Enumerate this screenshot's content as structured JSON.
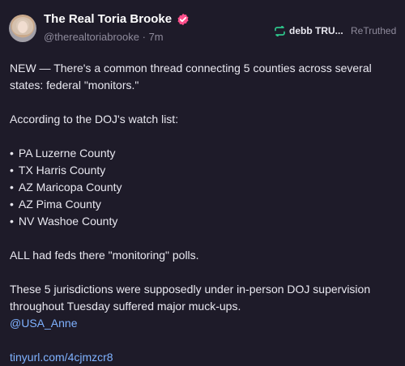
{
  "header": {
    "display_name": "The Real Toria Brooke",
    "handle": "@therealtoriabrooke",
    "separator": "·",
    "time_ago": "7m",
    "retruth_user": "debb TRU...",
    "retruth_label": "ReTruthed"
  },
  "icons": {
    "verified": "verified-badge-icon",
    "retruth": "retruth-arrows-icon"
  },
  "colors": {
    "background": "#1e1b29",
    "verified_badge": "#ff4f8b",
    "retruth_icon": "#2ec58b",
    "link": "#7fb2ff"
  },
  "post": {
    "intro": "NEW — There's a common thread connecting 5 counties across several states: federal \"monitors.\"",
    "watchlist_intro": "According to the DOJ's watch list:",
    "counties": [
      "PA Luzerne County",
      "TX Harris County",
      "AZ Maricopa County",
      "AZ Pima County",
      "NV Washoe County"
    ],
    "feds_line": "ALL had feds there \"monitoring\" polls.",
    "jurisdictions_line": "These 5 jurisdictions were supposedly under in-person DOJ supervision throughout Tuesday suffered major muck-ups.",
    "mention": "@USA_Anne",
    "link": "tinyurl.com/4cjmzcr8"
  }
}
